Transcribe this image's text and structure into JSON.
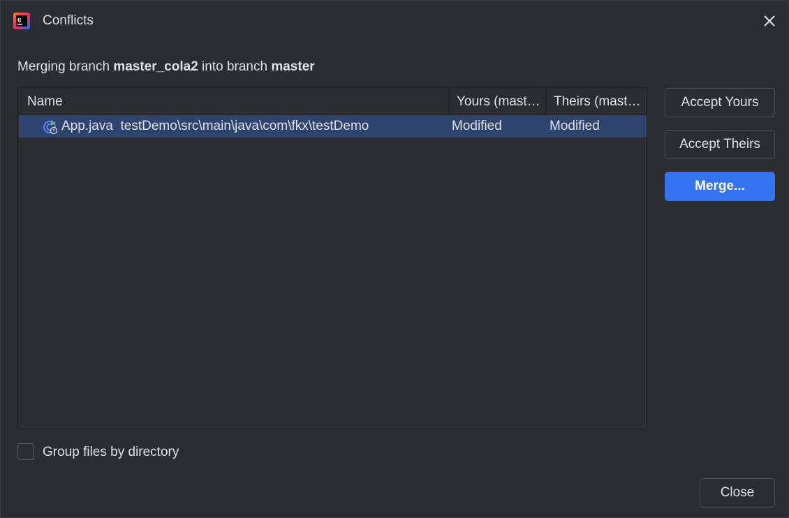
{
  "window": {
    "title": "Conflicts",
    "app_icon": "intellij-idea-icon",
    "close_icon": "close-icon"
  },
  "subtitle": {
    "prefix": "Merging branch ",
    "source_branch": "master_cola2",
    "middle": " into branch ",
    "target_branch": "master"
  },
  "table": {
    "columns": [
      "Name",
      "Yours (mast…",
      "Theirs (mast…"
    ],
    "rows": [
      {
        "file": "App.java",
        "path": "testDemo\\src\\main\\java\\com\\fkx\\testDemo",
        "yours": "Modified",
        "theirs": "Modified",
        "icon": "java-class-file-icon",
        "selected": true
      }
    ]
  },
  "buttons": {
    "accept_yours": "Accept Yours",
    "accept_theirs": "Accept Theirs",
    "merge": "Merge...",
    "close": "Close"
  },
  "options": {
    "group_by_directory_label": "Group files by directory",
    "group_by_directory_checked": false
  },
  "colors": {
    "background": "#2b2d30",
    "selection": "#2e436e",
    "accent": "#3574f0"
  }
}
